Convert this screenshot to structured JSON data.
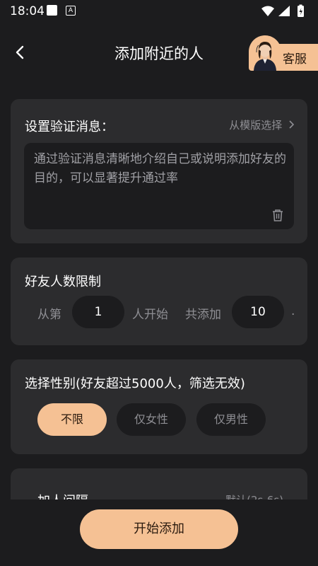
{
  "status_bar": {
    "time": "18:04",
    "notification_letter": "A"
  },
  "header": {
    "title": "添加附近的人",
    "customer_service_label": "客服"
  },
  "verify_section": {
    "title": "设置验证消息：",
    "template_link": "从模版选择",
    "message_text": "通过验证消息清晰地介绍自己或说明添加好友的目的，可以显著提升通过率"
  },
  "limit_section": {
    "title": "好友人数限制",
    "from_label": "从第",
    "start_value": "1",
    "start_suffix": "人开始",
    "total_label": "共添加",
    "total_value": "10",
    "trailing_dot": "."
  },
  "gender_section": {
    "title": "选择性别(好友超过5000人，筛选无效)",
    "options": [
      "不限",
      "仅女性",
      "仅男性"
    ],
    "selected": "不限"
  },
  "interval_section": {
    "title": "加人间隔",
    "value": "默认(2s-6s)"
  },
  "start_button": "开始添加",
  "colors": {
    "accent": "#f5c194",
    "background": "#1c1c1e",
    "card": "#2c2c2e"
  }
}
